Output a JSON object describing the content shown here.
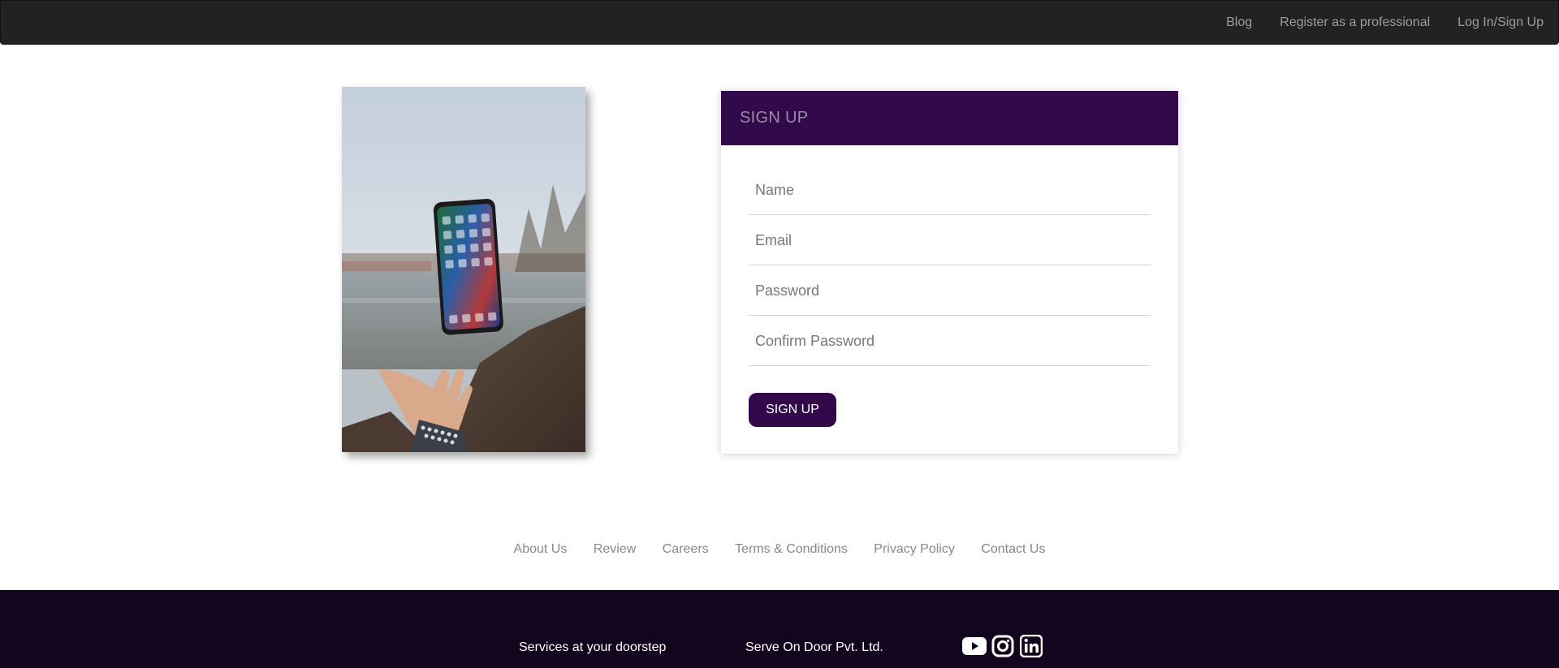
{
  "navbar": {
    "links": [
      "Blog",
      "Register as a professional",
      "Log In/Sign Up"
    ]
  },
  "hero": {
    "image_alt": "Hand tossing a smartphone above a lake"
  },
  "signup": {
    "title": "SIGN UP",
    "fields": {
      "name_placeholder": "Name",
      "email_placeholder": "Email",
      "password_placeholder": "Password",
      "confirm_placeholder": "Confirm Password"
    },
    "button_label": "SIGN UP"
  },
  "footer": {
    "links": [
      "About Us",
      "Review",
      "Careers",
      "Terms & Conditions",
      "Privacy Policy",
      "Contact Us"
    ],
    "tagline": "Services at your doorstep",
    "company": "Serve On Door Pvt. Ltd.",
    "social_icons": [
      "youtube-icon",
      "instagram-icon",
      "linkedin-icon"
    ]
  },
  "colors": {
    "brand_purple": "#320a4b",
    "navbar_bg": "#222222",
    "footer_bg": "#13051d"
  }
}
